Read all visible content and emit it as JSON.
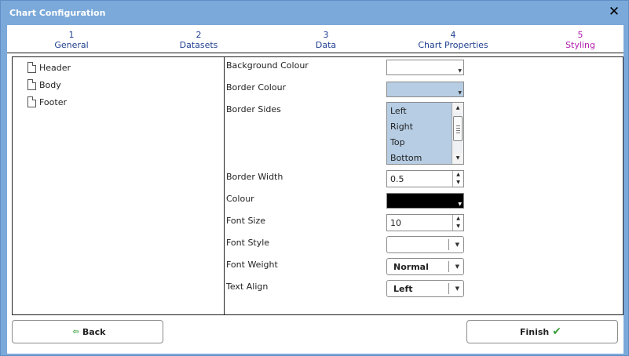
{
  "window": {
    "title": "Chart Configuration"
  },
  "steps": [
    {
      "number": "1",
      "label": "General"
    },
    {
      "number": "2",
      "label": "Datasets"
    },
    {
      "number": "3",
      "label": "Data"
    },
    {
      "number": "4",
      "label": "Chart Properties"
    },
    {
      "number": "5",
      "label": "Styling"
    }
  ],
  "tree": {
    "items": [
      "Header",
      "Body",
      "Footer"
    ]
  },
  "form": {
    "background_colour": {
      "label": "Background Colour",
      "value": "#ffffff"
    },
    "border_colour": {
      "label": "Border Colour",
      "value": "#b7cde3"
    },
    "border_sides": {
      "label": "Border Sides",
      "options": [
        "Left",
        "Right",
        "Top",
        "Bottom"
      ]
    },
    "border_width": {
      "label": "Border Width",
      "value": "0.5"
    },
    "colour": {
      "label": "Colour",
      "value": "#000000"
    },
    "font_size": {
      "label": "Font Size",
      "value": "10"
    },
    "font_style": {
      "label": "Font Style",
      "value": ""
    },
    "font_weight": {
      "label": "Font Weight",
      "value": "Normal"
    },
    "text_align": {
      "label": "Text Align",
      "value": "Left"
    }
  },
  "buttons": {
    "back": "Back",
    "finish": "Finish"
  },
  "colors": {
    "accent_blue": "#7aa9da",
    "step_text": "#1f3f8f",
    "step_active": "#b020b0",
    "finish_check": "#3aa03a",
    "back_arrow": "#3aa03a"
  },
  "icons": {
    "close": "close-icon",
    "document": "document-icon",
    "back": "back-arrow-icon",
    "finish": "check-icon"
  }
}
